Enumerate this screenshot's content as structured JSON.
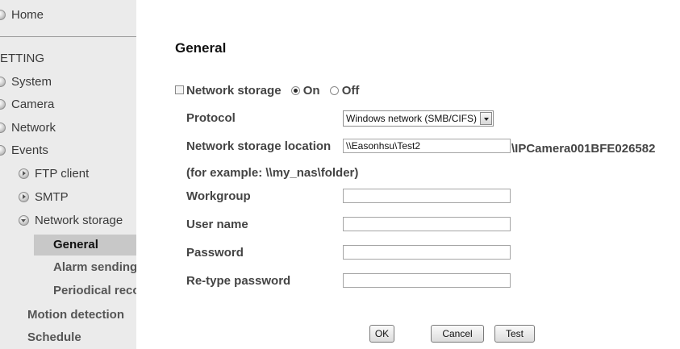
{
  "sidebar": {
    "home": "Home",
    "setting_header": "ETTING",
    "items": {
      "system": "System",
      "camera": "Camera",
      "network": "Network",
      "events": "Events",
      "ftp": "FTP client",
      "smtp": "SMTP",
      "network_storage": "Network storage",
      "general": "General",
      "alarm_sending": "Alarm sending",
      "periodical": "Periodical recording",
      "motion": "Motion detection",
      "schedule": "Schedule"
    }
  },
  "main": {
    "title": "General",
    "network_storage_label": "Network storage",
    "on_label": "On",
    "off_label": "Off",
    "network_storage_enabled": true,
    "protocol_label": "Protocol",
    "protocol_value": "Windows network (SMB/CIFS)",
    "location_label": "Network storage location",
    "location_value": "\\\\Easonhsu\\Test2",
    "location_suffix": "\\IPCamera001BFE026582",
    "example_text": "(for example: \\\\my_nas\\folder)",
    "workgroup_label": "Workgroup",
    "workgroup_value": "",
    "username_label": "User name",
    "username_value": "",
    "password_label": "Password",
    "password_value": "",
    "retype_label": "Re-type password",
    "retype_value": ""
  },
  "buttons": {
    "ok": "OK",
    "cancel": "Cancel",
    "test": "Test"
  }
}
